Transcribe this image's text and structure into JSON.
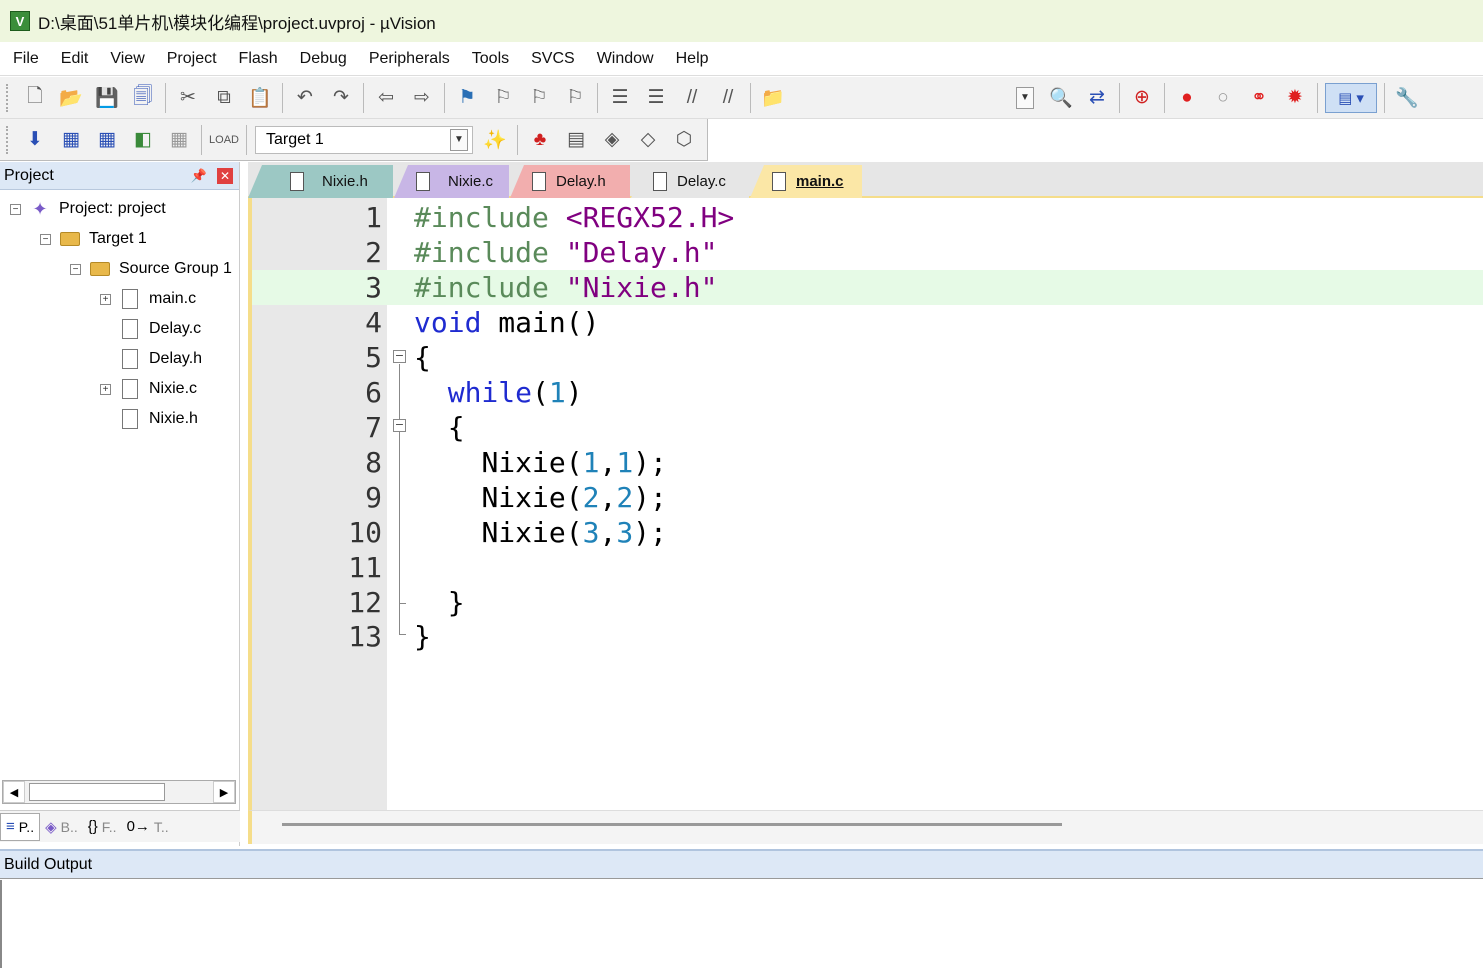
{
  "window": {
    "title": "D:\\桌面\\51单片机\\模块化编程\\project.uvproj - µVision",
    "icon_letter": "V"
  },
  "menu": [
    "File",
    "Edit",
    "View",
    "Project",
    "Flash",
    "Debug",
    "Peripherals",
    "Tools",
    "SVCS",
    "Window",
    "Help"
  ],
  "toolbar2": {
    "target": "Target 1"
  },
  "project_panel": {
    "title": "Project",
    "tree": [
      {
        "label": "Project: project",
        "expander": "−"
      },
      {
        "label": "Target 1",
        "expander": "−"
      },
      {
        "label": "Source Group 1",
        "expander": "−"
      },
      {
        "label": "main.c",
        "expander": "+"
      },
      {
        "label": "Delay.c",
        "expander": ""
      },
      {
        "label": "Delay.h",
        "expander": ""
      },
      {
        "label": "Nixie.c",
        "expander": "+"
      },
      {
        "label": "Nixie.h",
        "expander": ""
      }
    ],
    "bottom_tabs": [
      {
        "icon": "≡",
        "label": "P.."
      },
      {
        "icon": "◈",
        "label": "B.."
      },
      {
        "icon": "{}",
        "label": "F.."
      },
      {
        "icon": "0→",
        "label": "T.."
      }
    ]
  },
  "editor_tabs": [
    {
      "label": "Nixie.h",
      "color": "#9cc8c4"
    },
    {
      "label": "Nixie.c",
      "color": "#c8b6e6"
    },
    {
      "label": "Delay.h",
      "color": "#f2aeae"
    },
    {
      "label": "Delay.c",
      "color": "#e6e6e6"
    },
    {
      "label": "main.c",
      "color": "#fbe7a6",
      "active": true
    }
  ],
  "code": {
    "line_numbers": [
      "1",
      "2",
      "3",
      "4",
      "5",
      "6",
      "7",
      "8",
      "9",
      "10",
      "11",
      "12",
      "13"
    ],
    "lines": {
      "l1": {
        "pp": "#include",
        "str": "<REGX52.H>"
      },
      "l2": {
        "pp": "#include",
        "str": "\"Delay.h\""
      },
      "l3": {
        "pp": "#include",
        "str": "\"Nixie.h\""
      },
      "l4": {
        "kw": "void",
        "rest": "main()"
      },
      "l5": {
        "text": "{"
      },
      "l6": {
        "kw": "while",
        "a": "(",
        "n": "1",
        "b": ")"
      },
      "l7": {
        "text": "{"
      },
      "l8": {
        "fn": "Nixie(",
        "n1": "1",
        "c": ",",
        "n2": "1",
        "end": ");"
      },
      "l9": {
        "fn": "Nixie(",
        "n1": "2",
        "c": ",",
        "n2": "2",
        "end": ");"
      },
      "l10": {
        "fn": "Nixie(",
        "n1": "3",
        "c": ",",
        "n2": "3",
        "end": ");"
      },
      "l12": {
        "text": "}"
      },
      "l13": {
        "text": "}"
      }
    }
  },
  "build_output": {
    "title": "Build Output"
  }
}
